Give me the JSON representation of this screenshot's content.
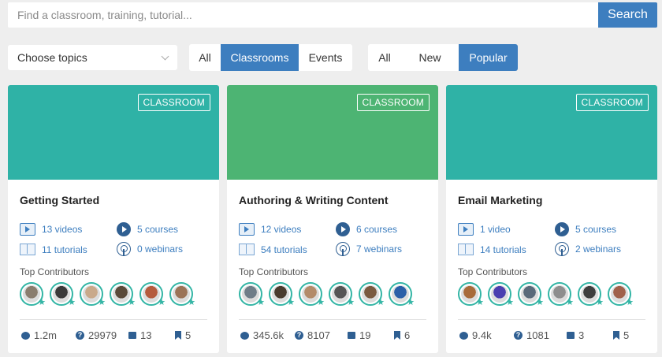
{
  "search": {
    "placeholder": "Find a classroom, training, tutorial...",
    "button_label": "Search"
  },
  "filters": {
    "topics_label": "Choose topics",
    "type_tabs": [
      "All",
      "Classrooms",
      "Events"
    ],
    "type_active": "Classrooms",
    "sort_tabs": [
      "All",
      "New",
      "Popular"
    ],
    "sort_active": "Popular"
  },
  "colors": {
    "accent": "#3d7ebf",
    "teal": "#2fb2a6",
    "green": "#4db473",
    "badge_border": "#ffffff"
  },
  "cards": [
    {
      "badge": "CLASSROOM",
      "banner_color": "#2fb2a6",
      "title": "Getting Started",
      "videos": "13 videos",
      "courses": "5 courses",
      "tutorials": "11 tutorials",
      "webinars": "0 webinars",
      "contributors_label": "Top Contributors",
      "avatar_colors": [
        "#8a7d6e",
        "#3a3a3a",
        "#c9a98a",
        "#5a4a3a",
        "#b55b3d",
        "#9b7357"
      ],
      "comments": "1.2m",
      "questions": "29979",
      "items": "13",
      "bookmarks": "5"
    },
    {
      "badge": "CLASSROOM",
      "banner_color": "#4db473",
      "title": "Authoring & Writing Content",
      "videos": "12 videos",
      "courses": "6 courses",
      "tutorials": "54 tutorials",
      "webinars": "7 webinars",
      "contributors_label": "Top Contributors",
      "avatar_colors": [
        "#6f7d88",
        "#4a3b2e",
        "#b38b6a",
        "#555555",
        "#7a5a40",
        "#2b5fa8"
      ],
      "comments": "345.6k",
      "questions": "8107",
      "items": "19",
      "bookmarks": "6"
    },
    {
      "badge": "CLASSROOM",
      "banner_color": "#2fb2a6",
      "title": "Email Marketing",
      "videos": "1 video",
      "courses": "5 courses",
      "tutorials": "14 tutorials",
      "webinars": "2 webinars",
      "contributors_label": "Top Contributors",
      "avatar_colors": [
        "#a86b3a",
        "#4b3fb0",
        "#5a6a7a",
        "#8e8e8e",
        "#3e3e3e",
        "#a0604a"
      ],
      "comments": "9.4k",
      "questions": "1081",
      "items": "3",
      "bookmarks": "5"
    }
  ]
}
